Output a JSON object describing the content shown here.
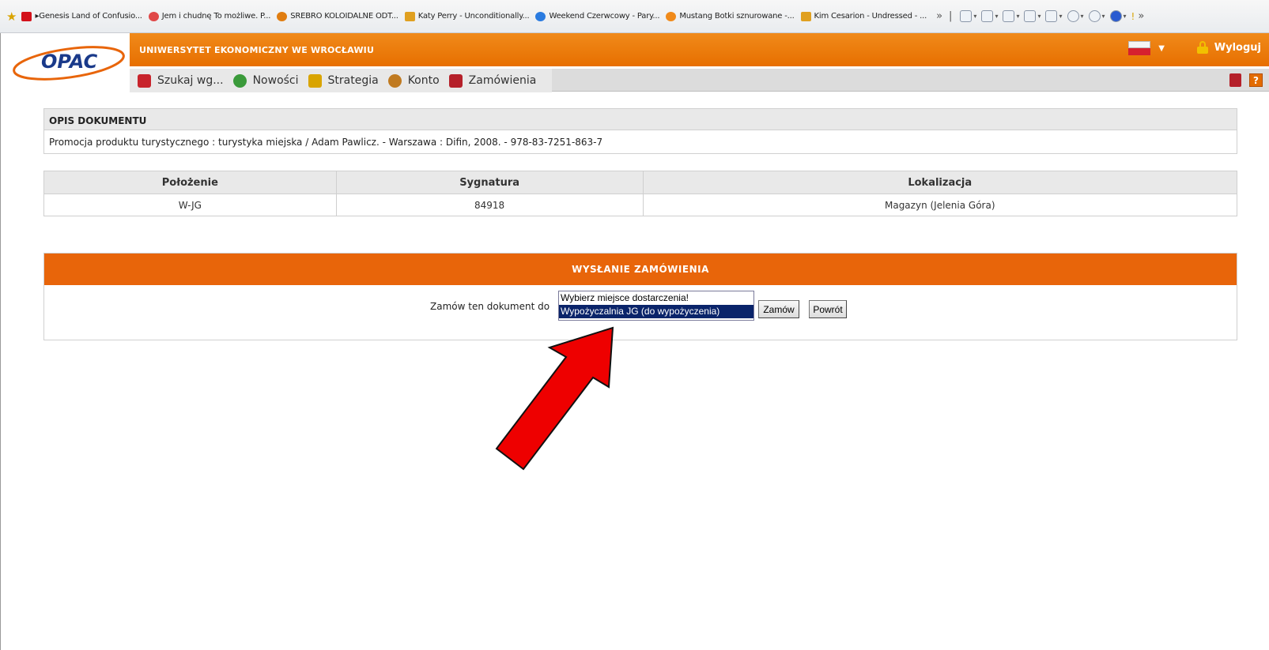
{
  "favorites_bar": {
    "items": [
      {
        "label": "▸Genesis Land of Confusio...",
        "color": "#d3121b"
      },
      {
        "label": "Jem i chudnę To możliwe. P...",
        "color": "#e04848"
      },
      {
        "label": "SREBRO KOLOIDALNE ODT...",
        "color": "#e07d10"
      },
      {
        "label": "Katy Perry - Unconditionally...",
        "color": "#e0a020"
      },
      {
        "label": "Weekend Czerwcowy - Pary...",
        "color": "#2a7be0"
      },
      {
        "label": "Mustang Botki sznurowane -...",
        "color": "#f08a1a"
      },
      {
        "label": "Kim Cesarion - Undressed - ...",
        "color": "#e0a020"
      }
    ],
    "overflow": "»"
  },
  "header": {
    "logo_text": "OPAC",
    "university": "UNIWERSYTET EKONOMICZNY WE WROCŁAWIU",
    "logout_label": "Wyloguj",
    "help_label": "?"
  },
  "nav": {
    "tabs": [
      {
        "label": "Szukaj wg...",
        "color": "#c8242c"
      },
      {
        "label": "Nowości",
        "color": "#3a9a3a"
      },
      {
        "label": "Strategia",
        "color": "#d9a400"
      },
      {
        "label": "Konto",
        "color": "#c07a20"
      },
      {
        "label": "Zamówienia",
        "color": "#b5202a"
      }
    ]
  },
  "description": {
    "heading": "OPIS DOKUMENTU",
    "text": "Promocja produktu turystycznego : turystyka miejska / Adam Pawlicz. - Warszawa : Difin, 2008. - 978-83-7251-863-7"
  },
  "holdings": {
    "columns": [
      "Położenie",
      "Sygnatura",
      "Lokalizacja"
    ],
    "rows": [
      [
        "W-JG",
        "84918",
        "Magazyn (Jelenia Góra)"
      ]
    ]
  },
  "order": {
    "heading": "WYSŁANIE ZAMÓWIENIA",
    "label": "Zamów ten dokument do",
    "options": [
      "Wybierz miejsce dostarczenia!",
      "Wypożyczalnia JG (do wypożyczenia)"
    ],
    "selected": "Wypożyczalnia JG (do wypożyczenia)",
    "submit_label": "Zamów",
    "back_label": "Powrót"
  },
  "colors": {
    "brand_orange": "#e8650a",
    "selection_blue": "#0a246a",
    "arrow_red": "#ee0000"
  }
}
